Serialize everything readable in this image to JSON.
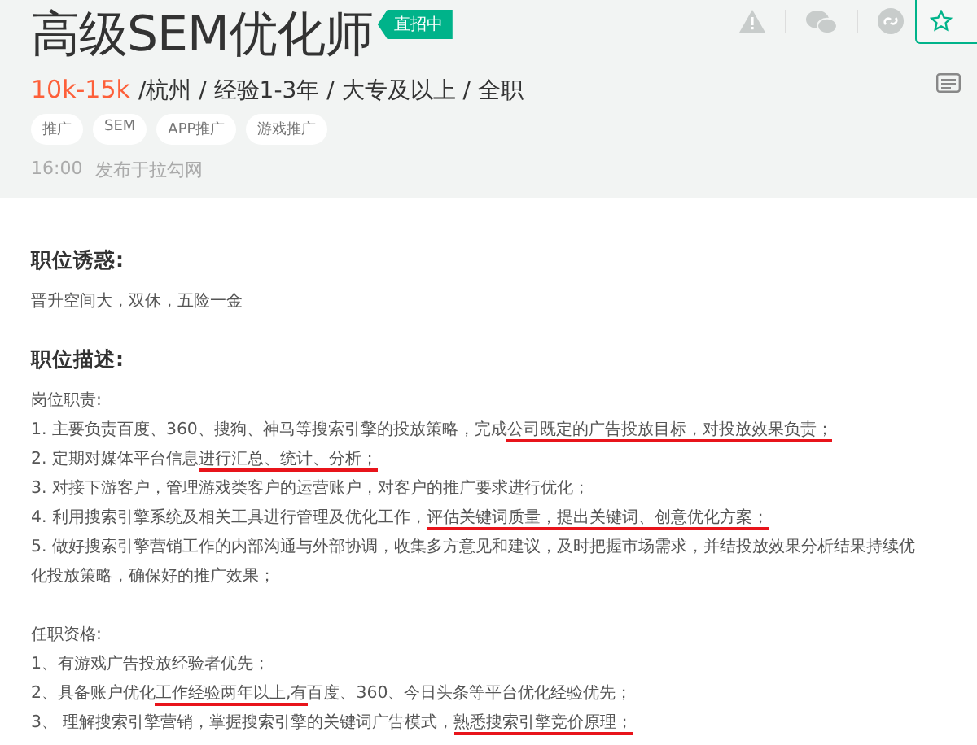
{
  "header": {
    "title": "高级SEM优化师",
    "badge": "直招中",
    "salary": "10k-15k",
    "meta": "/杭州 / 经验1-3年 / 大专及以上 / 全职",
    "tags": [
      "推广",
      "SEM",
      "APP推广",
      "游戏推广"
    ],
    "time": "16:00",
    "source": "发布于拉勾网"
  },
  "sections": [
    {
      "heading": "职位诱惑:",
      "blocks": [
        [
          {
            "parts": [
              {
                "text": "晋升空间大，双休，五险一金",
                "marked": false
              }
            ]
          }
        ]
      ]
    },
    {
      "heading": "职位描述:",
      "blocks": [
        [
          {
            "parts": [
              {
                "text": "岗位职责:",
                "marked": false
              }
            ]
          },
          {
            "parts": [
              {
                "text": "1. 主要负责百度、360、搜狗、神马等搜索引擎的投放策略，完成",
                "marked": false
              },
              {
                "text": "公司既定的广告投放目标，对投放效果负责；",
                "marked": true
              }
            ]
          },
          {
            "parts": [
              {
                "text": "2. 定期对媒体平台信息",
                "marked": false
              },
              {
                "text": "进行汇总、统计、分析；",
                "marked": true
              }
            ]
          },
          {
            "parts": [
              {
                "text": "3. 对接下游客户，管理游戏类客户的运营账户，对客户的推广要求进行优化；",
                "marked": false
              }
            ]
          },
          {
            "parts": [
              {
                "text": "4. 利用搜索引擎系统及相关工具进行管理及优化工作，",
                "marked": false
              },
              {
                "text": "评估关键词质量，提出关键词、创意优化方案；",
                "marked": true
              }
            ]
          },
          {
            "parts": [
              {
                "text": "5. 做好搜索引擎营销工作的内部沟通与外部协调，收集多方意见和建议，及时把握市场需求，并结投放效果分析结果持续优化投放策略，确保好的推广效果；",
                "marked": false
              }
            ]
          }
        ],
        [
          {
            "parts": [
              {
                "text": "任职资格:",
                "marked": false
              }
            ]
          },
          {
            "parts": [
              {
                "text": "1、有游戏广告投放经验者优先；",
                "marked": false
              }
            ]
          },
          {
            "parts": [
              {
                "text": "2、具备账户优化",
                "marked": false
              },
              {
                "text": "工作经验两年以上,有",
                "marked": true
              },
              {
                "text": "百度、360、今日头条等平台优化经验优先；",
                "marked": false
              }
            ]
          },
          {
            "parts": [
              {
                "text": "3、 理解搜索引擎营销，掌握搜索引擎的关键词广告模式，",
                "marked": false
              },
              {
                "text": "熟悉搜索引擎竞价原理；",
                "marked": true
              }
            ]
          }
        ]
      ]
    }
  ]
}
